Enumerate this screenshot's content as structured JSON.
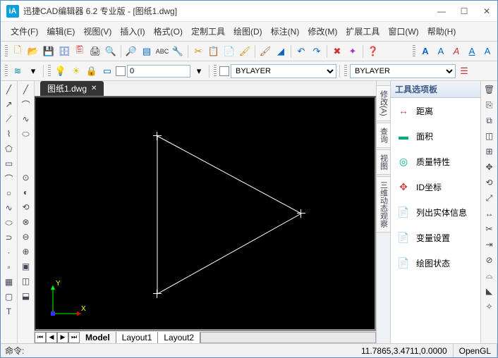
{
  "window": {
    "title": "迅捷CAD编辑器 6.2 专业版  -  [图纸1.dwg]"
  },
  "menu": {
    "items": [
      "文件(F)",
      "编辑(E)",
      "视图(V)",
      "插入(I)",
      "格式(O)",
      "定制工具",
      "绘图(D)",
      "标注(N)",
      "修改(M)",
      "扩展工具",
      "窗口(W)",
      "帮助(H)"
    ]
  },
  "toolbar2": {
    "layer_value": "0",
    "linetype": "BYLAYER",
    "lineweight": "BYLAYER"
  },
  "document": {
    "tab_name": "图纸1.dwg",
    "layouts": [
      "Model",
      "Layout1",
      "Layout2"
    ],
    "active_layout": "Model",
    "ucs": {
      "x_label": "X",
      "y_label": "Y"
    },
    "triangle": {
      "p1": [
        172,
        54
      ],
      "p2": [
        172,
        278
      ],
      "p3": [
        376,
        164
      ]
    }
  },
  "vtabs": [
    "修改(A)",
    "查询",
    "视图",
    "三维动态观察"
  ],
  "palette": {
    "title": "工具选项板",
    "items": [
      {
        "label": "距离",
        "icon": "↔",
        "color": "#c44"
      },
      {
        "label": "面积",
        "icon": "▬",
        "color": "#0a8"
      },
      {
        "label": "质量特性",
        "icon": "◎",
        "color": "#0a8"
      },
      {
        "label": "ID坐标",
        "icon": "✥",
        "color": "#c44"
      },
      {
        "label": "列出实体信息",
        "icon": "📄",
        "color": "#06c"
      },
      {
        "label": "变量设置",
        "icon": "📄",
        "color": "#888"
      },
      {
        "label": "绘图状态",
        "icon": "📄",
        "color": "#0aa0e0"
      }
    ]
  },
  "status": {
    "command_label": "命令:",
    "coords": "11.7865,3.4711,0.0000",
    "render": "OpenGL"
  },
  "text_style": {
    "letters": [
      "A",
      "A",
      "A",
      "A",
      "A"
    ]
  }
}
